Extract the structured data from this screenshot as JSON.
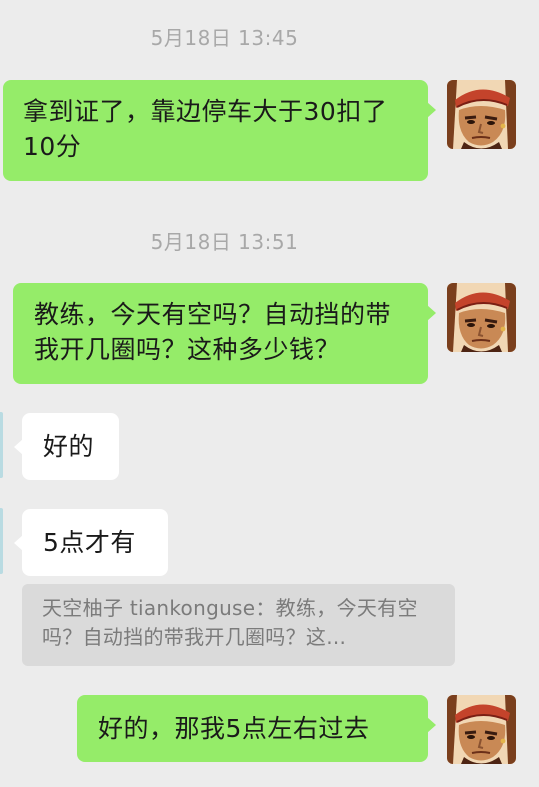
{
  "chat": {
    "timestamps": [
      "5月18日 13:45",
      "5月18日 13:51"
    ],
    "messages": [
      {
        "sender": "self",
        "text": "拿到证了，靠边停车大于30扣了10分"
      },
      {
        "sender": "self",
        "text": "教练，今天有空吗？自动挡的带我开几圈吗？这种多少钱？"
      },
      {
        "sender": "other",
        "text": "好的"
      },
      {
        "sender": "other",
        "text": "5点才有"
      },
      {
        "sender": "self",
        "text": "好的，那我5点左右过去"
      }
    ],
    "quote": {
      "text": "天空柚子 tiankonguse：教练，今天有空吗？自动挡的带我开几圈吗？这..."
    }
  },
  "colors": {
    "background": "#ececec",
    "outgoing_bubble": "#95ec69",
    "incoming_bubble": "#ffffff",
    "timestamp": "#a8a8a8",
    "quote_background": "#dadada"
  },
  "icons": {
    "self_avatar": "cartoon-pirate-avatar-icon"
  }
}
